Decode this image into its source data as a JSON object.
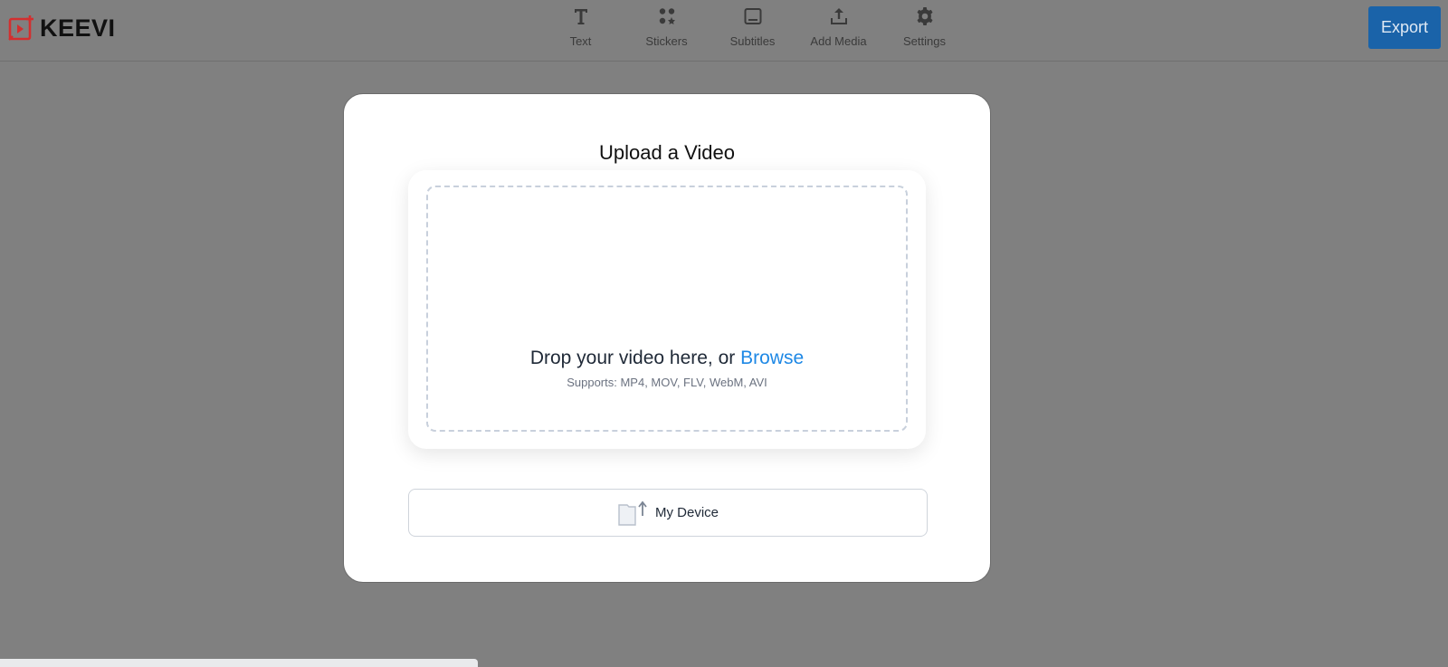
{
  "app": {
    "logo_text": "KEEVI",
    "brand_color": "#d32f2f",
    "accent_color": "#1a63a9"
  },
  "toolbar": {
    "items": [
      {
        "label": "Text",
        "icon": "text-icon"
      },
      {
        "label": "Stickers",
        "icon": "stickers-icon"
      },
      {
        "label": "Subtitles",
        "icon": "subtitles-icon"
      },
      {
        "label": "Add Media",
        "icon": "upload-icon"
      },
      {
        "label": "Settings",
        "icon": "gear-icon"
      }
    ],
    "export_label": "Export"
  },
  "upload_modal": {
    "title": "Upload a Video",
    "drop_text": "Drop your video here, or ",
    "browse_label": "Browse",
    "browse_color": "#1e88e5",
    "supports_text": "Supports: MP4, MOV, FLV, WebM, AVI",
    "device_button_label": "My Device",
    "device_icon": "folder-upload-icon"
  },
  "toast": {
    "text": ""
  }
}
